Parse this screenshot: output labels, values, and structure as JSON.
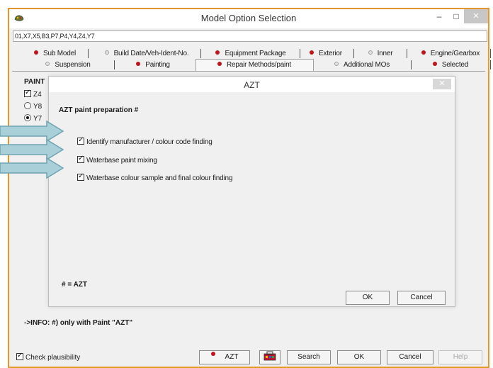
{
  "window": {
    "title": "Model Option Selection",
    "minimize": "–",
    "maximize": "□",
    "close": "✕"
  },
  "options_field": {
    "value": "01,X7,X5,B3,P7,P4,Y4,Z4,Y7"
  },
  "tabs_row1": [
    {
      "label": "Sub Model",
      "status": "red"
    },
    {
      "label": "Build Date/Veh-Ident-No.",
      "status": "grey"
    },
    {
      "label": "Equipment Package",
      "status": "red"
    },
    {
      "label": "Exterior",
      "status": "red"
    },
    {
      "label": "Inner",
      "status": "grey"
    },
    {
      "label": "Engine/Gearbox",
      "status": "red"
    }
  ],
  "tabs_row2": [
    {
      "label": "Suspension",
      "status": "grey"
    },
    {
      "label": "Painting",
      "status": "red"
    },
    {
      "label": "Repair Methods/paint",
      "status": "red",
      "active": true
    },
    {
      "label": "Additional MOs",
      "status": "grey"
    },
    {
      "label": "Selected",
      "status": "red"
    }
  ],
  "painting": {
    "label": "PAINT",
    "options": [
      {
        "label": "Z4",
        "control": "checkbox",
        "checked": true
      },
      {
        "label": "Y8",
        "control": "radio",
        "checked": false
      },
      {
        "label": "Y7",
        "control": "radio",
        "checked": true
      }
    ]
  },
  "info_text": "->INFO: #) only with Paint \"AZT\"",
  "footer": {
    "plausibility_label": "Check plausibility",
    "plausibility_checked": true,
    "azt_label": "AZT",
    "search_label": "Search",
    "ok_label": "OK",
    "cancel_label": "Cancel",
    "help_label": "Help"
  },
  "dialog": {
    "title": "AZT",
    "close": "✕",
    "heading": "AZT paint preparation #",
    "items": [
      {
        "label": "Identify manufacturer / colour code finding",
        "checked": true
      },
      {
        "label": "Waterbase paint mixing",
        "checked": true
      },
      {
        "label": "Waterbase colour sample and final colour finding",
        "checked": true
      }
    ],
    "note": "# = AZT",
    "ok_label": "OK",
    "cancel_label": "Cancel"
  },
  "colors": {
    "frame_border": "#e8962a",
    "status_red": "#c0141a",
    "arrow_fill": "#a9cfd9",
    "arrow_stroke": "#6fa3b3"
  }
}
